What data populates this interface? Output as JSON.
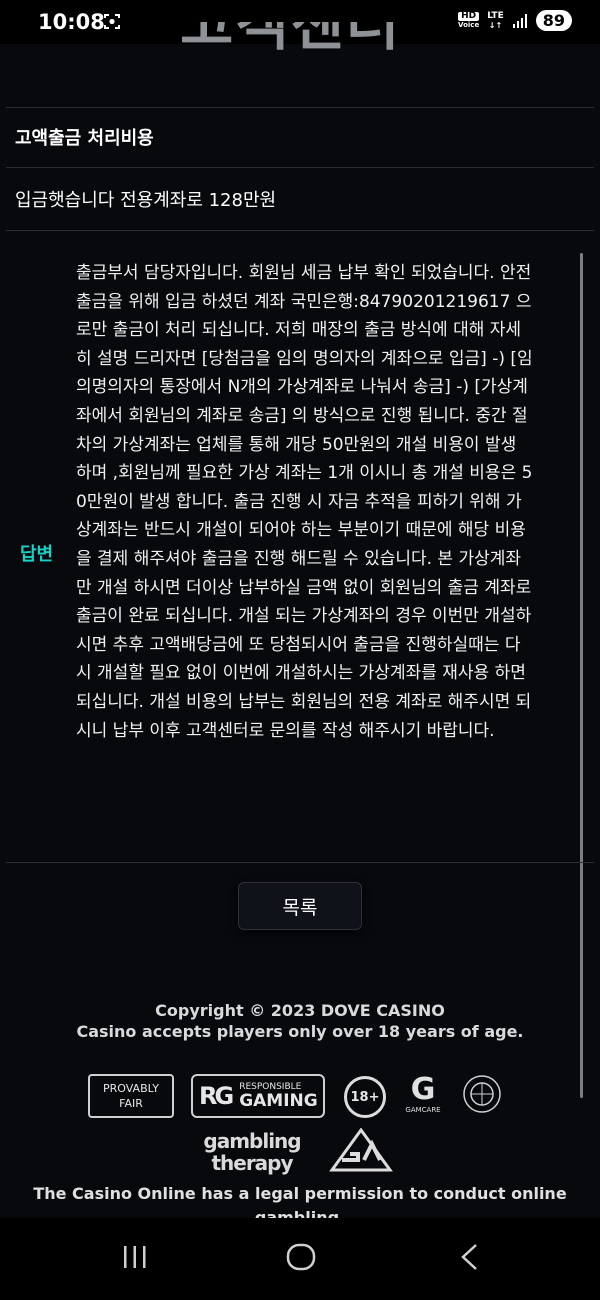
{
  "status_bar": {
    "time": "10:08",
    "hd_top": "HD",
    "hd_bottom": "Voice",
    "network": "LTE",
    "battery": "89"
  },
  "logo_fragment": "고객센터",
  "inquiry": {
    "subject": "고액출금 처리비용",
    "question": "입금햇습니다 전용계좌로 128만원"
  },
  "answer": {
    "label": "답변",
    "body": "출금부서 담당자입니다. 회원님 세금 납부 확인 되었습니다. 안전 출금을 위해 입금 하셨던 계좌 국민은행:84790201219617 으로만 출금이 처리 되십니다. 저희 매장의 출금 방식에 대해 자세히 설명 드리자면 [당첨금을 임의 명의자의 계좌으로 입금] -) [임의명의자의 통장에서 N개의 가상계좌로 나눠서 송금] -) [가상계좌에서 회원님의 계좌로 송금] 의 방식으로 진행 됩니다. 중간 절차의 가상계좌는 업체를 통해 개당 50만원의 개설 비용이 발생 하며 ,회원님께 필요한 가상 계좌는 1개 이시니 총 개설 비용은 50만원이 발생 합니다. 출금 진행 시 자금 추적을 피하기 위해 가상계좌는 반드시 개설이 되어야 하는 부분이기 때문에 해당 비용을 결제 해주셔야 출금을 진행 해드릴 수 있습니다. 본 가상계좌만 개설 하시면 더이상 납부하실 금액 없이 회원님의 출금 계좌로 출금이 완료 되십니다. 개설 되는 가상계좌의 경우 이번만 개설하시면 추후 고액배당금에 또 당첨되시어 출금을 진행하실때는 다시 개설할 필요 없이 이번에 개설하시는 가상계좌를 재사용 하면 되십니다. 개설 비용의 납부는 회원님의 전용 계좌로 해주시면 되시니 납부 이후 고객센터로 문의를 작성 해주시기 바랍니다."
  },
  "list_button": "목록",
  "footer": {
    "copyright": "Copyright © 2023 DOVE CASINO",
    "age_notice": "Casino accepts players only over 18 years of age.",
    "provably_line1": "PROVABLY",
    "provably_line2": "FAIR",
    "rg_mark": "RG",
    "rg_small": "RESPONSIBLE",
    "rg_big": "GAMING",
    "age_badge": "18+",
    "gamcare_label": "GAMCARE",
    "therapy_line1": "gambling",
    "therapy_line2": "therapy",
    "legal": "The Casino Online has a legal permission to conduct online gambling."
  },
  "colors": {
    "background": "#07090d",
    "answer_label": "#16d2c6",
    "divider": "#2a2e35"
  }
}
